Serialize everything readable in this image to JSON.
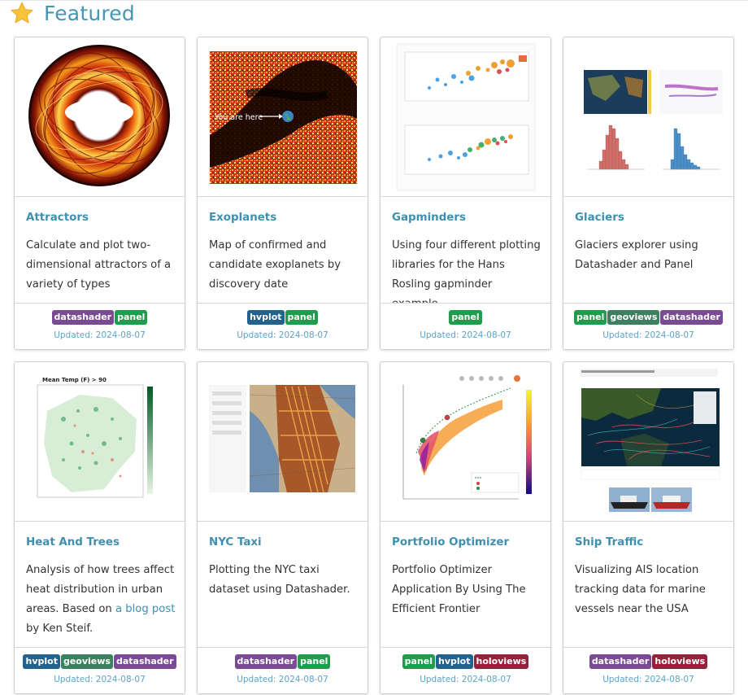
{
  "header": {
    "title": "Featured",
    "icon": "star-icon",
    "icon_color": "#f6c33a"
  },
  "tag_colors": {
    "datashader": "#7a4a95",
    "panel": "#1f9c4c",
    "hvplot": "#24628e",
    "geoviews": "#3c8060",
    "holoviews": "#95223a"
  },
  "cards": [
    {
      "title": "Attractors",
      "desc": "Calculate and plot two-dimensional attractors of a variety of types",
      "tags": [
        "datashader",
        "panel"
      ],
      "updated": "Updated: 2024-08-07"
    },
    {
      "title": "Exoplanets",
      "desc": "Map of confirmed and candidate exoplanets by discovery date",
      "tags": [
        "hvplot",
        "panel"
      ],
      "updated": "Updated: 2024-08-07",
      "thumb_label": "You are here"
    },
    {
      "title": "Gapminders",
      "desc": "Using four different plotting libraries for the Hans Rosling gapminder example",
      "tags": [
        "panel"
      ],
      "updated": "Updated: 2024-08-07"
    },
    {
      "title": "Glaciers",
      "desc": "Glaciers explorer using Datashader and Panel",
      "tags": [
        "panel",
        "geoviews",
        "datashader"
      ],
      "updated": "Updated: 2024-08-07"
    },
    {
      "title": "Heat And Trees",
      "desc_pre": "Analysis of how trees affect heat distribution in urban areas. Based on ",
      "desc_link": "a blog post",
      "desc_post": " by Ken Steif.",
      "tags": [
        "hvplot",
        "geoviews",
        "datashader"
      ],
      "updated": "Updated: 2024-08-07",
      "thumb_label": "Mean Temp (F) > 90"
    },
    {
      "title": "NYC Taxi",
      "desc": "Plotting the NYC taxi dataset using Datashader.",
      "tags": [
        "datashader",
        "panel"
      ],
      "updated": "Updated: 2024-08-07"
    },
    {
      "title": "Portfolio Optimizer",
      "desc": "Portfolio Optimizer Application By Using The Efficient Frontier",
      "tags": [
        "panel",
        "hvplot",
        "holoviews"
      ],
      "updated": "Updated: 2024-08-07"
    },
    {
      "title": "Ship Traffic",
      "desc": "Visualizing AIS location tracking data for marine vessels near the USA",
      "tags": [
        "datashader",
        "holoviews"
      ],
      "updated": "Updated: 2024-08-07"
    }
  ]
}
